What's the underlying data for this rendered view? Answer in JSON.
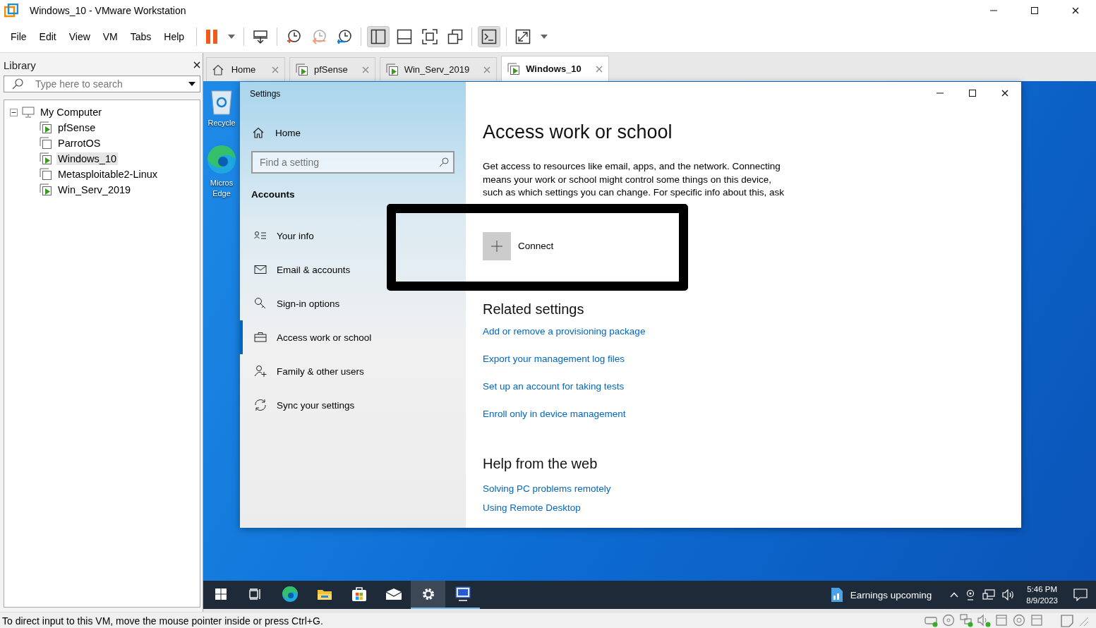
{
  "window": {
    "title": "Windows_10 - VMware Workstation"
  },
  "menu": [
    "File",
    "Edit",
    "View",
    "VM",
    "Tabs",
    "Help"
  ],
  "toolbar": [
    [
      {
        "kind": "pause",
        "pressed": false
      },
      {
        "kind": "caret",
        "pressed": false
      }
    ],
    [
      {
        "kind": "send-keys",
        "pressed": false
      }
    ],
    [
      {
        "kind": "snapshot",
        "pressed": false
      },
      {
        "kind": "revert",
        "pressed": false
      },
      {
        "kind": "snapshot-manager",
        "pressed": false
      }
    ],
    [
      {
        "kind": "library-view",
        "pressed": true
      },
      {
        "kind": "thumbnail-bar",
        "pressed": false
      },
      {
        "kind": "full-screen",
        "pressed": false
      },
      {
        "kind": "unity",
        "pressed": false
      }
    ],
    [
      {
        "kind": "console",
        "pressed": true
      }
    ],
    [
      {
        "kind": "stretch",
        "pressed": false
      },
      {
        "kind": "caret",
        "pressed": false
      }
    ]
  ],
  "library": {
    "title": "Library",
    "search": {
      "placeholder": "Type here to search"
    },
    "tree": [
      {
        "label": "My Computer",
        "kind": "computer",
        "expanded": true,
        "selected": false,
        "children": [
          {
            "label": "pfSense",
            "kind": "vm",
            "running": true,
            "selected": false
          },
          {
            "label": "ParrotOS",
            "kind": "vm",
            "running": false,
            "selected": false
          },
          {
            "label": "Windows_10",
            "kind": "vm",
            "running": true,
            "selected": true
          },
          {
            "label": "Metasploitable2-Linux",
            "kind": "vm",
            "running": false,
            "selected": false
          },
          {
            "label": "Win_Serv_2019",
            "kind": "vm",
            "running": true,
            "selected": false
          }
        ]
      }
    ]
  },
  "tabs": [
    {
      "label": "Home",
      "kind": "home",
      "selected": false
    },
    {
      "label": "pfSense",
      "kind": "vm",
      "selected": false
    },
    {
      "label": "Win_Serv_2019",
      "kind": "vm",
      "selected": false
    },
    {
      "label": "Windows_10",
      "kind": "vm",
      "selected": true
    }
  ],
  "desktop": {
    "icons": [
      {
        "label": "Recycle",
        "kind": "recycle-bin"
      },
      {
        "label": "Micros\nEdge",
        "kind": "edge"
      }
    ]
  },
  "settings": {
    "title": "Settings",
    "home": "Home",
    "search": {
      "placeholder": "Find a setting"
    },
    "section": "Accounts",
    "nav": [
      {
        "label": "Your info",
        "kind": "person-card",
        "selected": false
      },
      {
        "label": "Email & accounts",
        "kind": "envelope",
        "selected": false
      },
      {
        "label": "Sign-in options",
        "kind": "key",
        "selected": false
      },
      {
        "label": "Access work or school",
        "kind": "briefcase",
        "selected": true
      },
      {
        "label": "Family & other users",
        "kind": "person-plus",
        "selected": false
      },
      {
        "label": "Sync your settings",
        "kind": "sync",
        "selected": false
      }
    ],
    "page": {
      "title": "Access work or school",
      "description": "Get access to resources like email, apps, and the network. Connecting\nmeans your work or school might control some things on this device,\nsuch as which settings you can change. For specific info about this, ask",
      "connect": "Connect",
      "related": {
        "title": "Related settings",
        "links": [
          "Add or remove a provisioning package",
          "Export your management log files",
          "Set up an account for taking tests",
          "Enroll only in device management"
        ]
      },
      "help": {
        "title": "Help from the web",
        "links": [
          "Solving PC problems remotely",
          "Using Remote Desktop"
        ]
      }
    }
  },
  "taskbar": {
    "apps": [
      {
        "kind": "start",
        "active": false,
        "open": false
      },
      {
        "kind": "task-view",
        "active": false,
        "open": false
      },
      {
        "kind": "edge",
        "active": false,
        "open": false
      },
      {
        "kind": "explorer",
        "active": false,
        "open": false
      },
      {
        "kind": "store",
        "active": false,
        "open": false
      },
      {
        "kind": "mail",
        "active": false,
        "open": false
      },
      {
        "kind": "settings",
        "active": true,
        "open": true
      },
      {
        "kind": "vm-app",
        "active": false,
        "open": true
      }
    ],
    "news": "Earnings upcoming",
    "tray": [
      {
        "kind": "chevron"
      },
      {
        "kind": "camera"
      },
      {
        "kind": "network"
      },
      {
        "kind": "speaker"
      }
    ],
    "time": "5:46 PM",
    "date": "8/9/2023"
  },
  "status_bar": {
    "message": "To direct input to this VM, move the mouse pointer inside or press Ctrl+G.",
    "devices": [
      {
        "kind": "hdd",
        "connected": true
      },
      {
        "kind": "cd",
        "connected": false
      },
      {
        "kind": "network",
        "connected": true
      },
      {
        "kind": "sound",
        "connected": true
      },
      {
        "kind": "printer",
        "connected": false
      },
      {
        "kind": "usb",
        "connected": false
      },
      {
        "kind": "floppy",
        "connected": false
      }
    ]
  }
}
